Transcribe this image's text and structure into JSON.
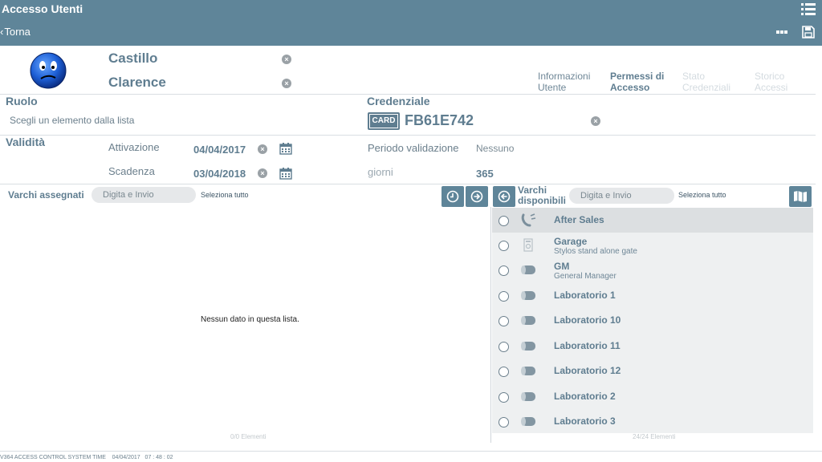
{
  "app": {
    "title": "Accesso Utenti"
  },
  "nav": {
    "back_label": "Torna"
  },
  "user": {
    "last_name": "Castillo",
    "first_name": "Clarence"
  },
  "tabs": [
    {
      "label": "Informazioni Utente",
      "state": "normal"
    },
    {
      "label": "Permessi di Accesso",
      "state": "active"
    },
    {
      "label": "Stato Credenziali",
      "state": "disabled"
    },
    {
      "label": "Storico Accessi",
      "state": "disabled"
    }
  ],
  "role": {
    "title": "Ruolo",
    "placeholder": "Scegli un elemento dalla lista"
  },
  "credential": {
    "title": "Credenziale",
    "badge": "CARD",
    "code": "FB61E742"
  },
  "validity": {
    "title": "Validità",
    "activation_label": "Attivazione",
    "activation_value": "04/04/2017",
    "expiry_label": "Scadenza",
    "expiry_value": "03/04/2018",
    "period_label": "Periodo validazione",
    "period_value": "Nessuno",
    "days_label": "giorni",
    "days_value": "365"
  },
  "assigned": {
    "title": "Varchi assegnati",
    "search_placeholder": "Digita e Invio",
    "select_all": "Seleziona tutto",
    "empty_message": "Nessun dato in questa lista.",
    "count": "0/0 Elementi"
  },
  "available": {
    "title": "Varchi disponibili",
    "search_placeholder": "Digita e Invio",
    "select_all": "Seleziona tutto",
    "count": "24/24 Elementi",
    "items": [
      {
        "name": "After Sales",
        "desc": "",
        "icon": "handset-icon",
        "selected": true
      },
      {
        "name": "Garage",
        "desc": "Stylos stand alone gate",
        "icon": "gate-reader-icon"
      },
      {
        "name": "GM",
        "desc": "General Manager",
        "icon": "cylinder-lock-icon"
      },
      {
        "name": "Laboratorio 1",
        "desc": "",
        "icon": "cylinder-lock-icon"
      },
      {
        "name": "Laboratorio 10",
        "desc": "",
        "icon": "cylinder-lock-icon"
      },
      {
        "name": "Laboratorio 11",
        "desc": "",
        "icon": "cylinder-lock-icon"
      },
      {
        "name": "Laboratorio 12",
        "desc": "",
        "icon": "cylinder-lock-icon"
      },
      {
        "name": "Laboratorio 2",
        "desc": "",
        "icon": "cylinder-lock-icon"
      },
      {
        "name": "Laboratorio 3",
        "desc": "",
        "icon": "cylinder-lock-icon"
      }
    ]
  },
  "footer": {
    "text": "V364 ACCESS CONTROL SYSTEM TIME",
    "date": "04/04/2017",
    "time": "07 : 48 : 02"
  },
  "colors": {
    "header": "#5f8599",
    "accent": "#5f7d90"
  }
}
